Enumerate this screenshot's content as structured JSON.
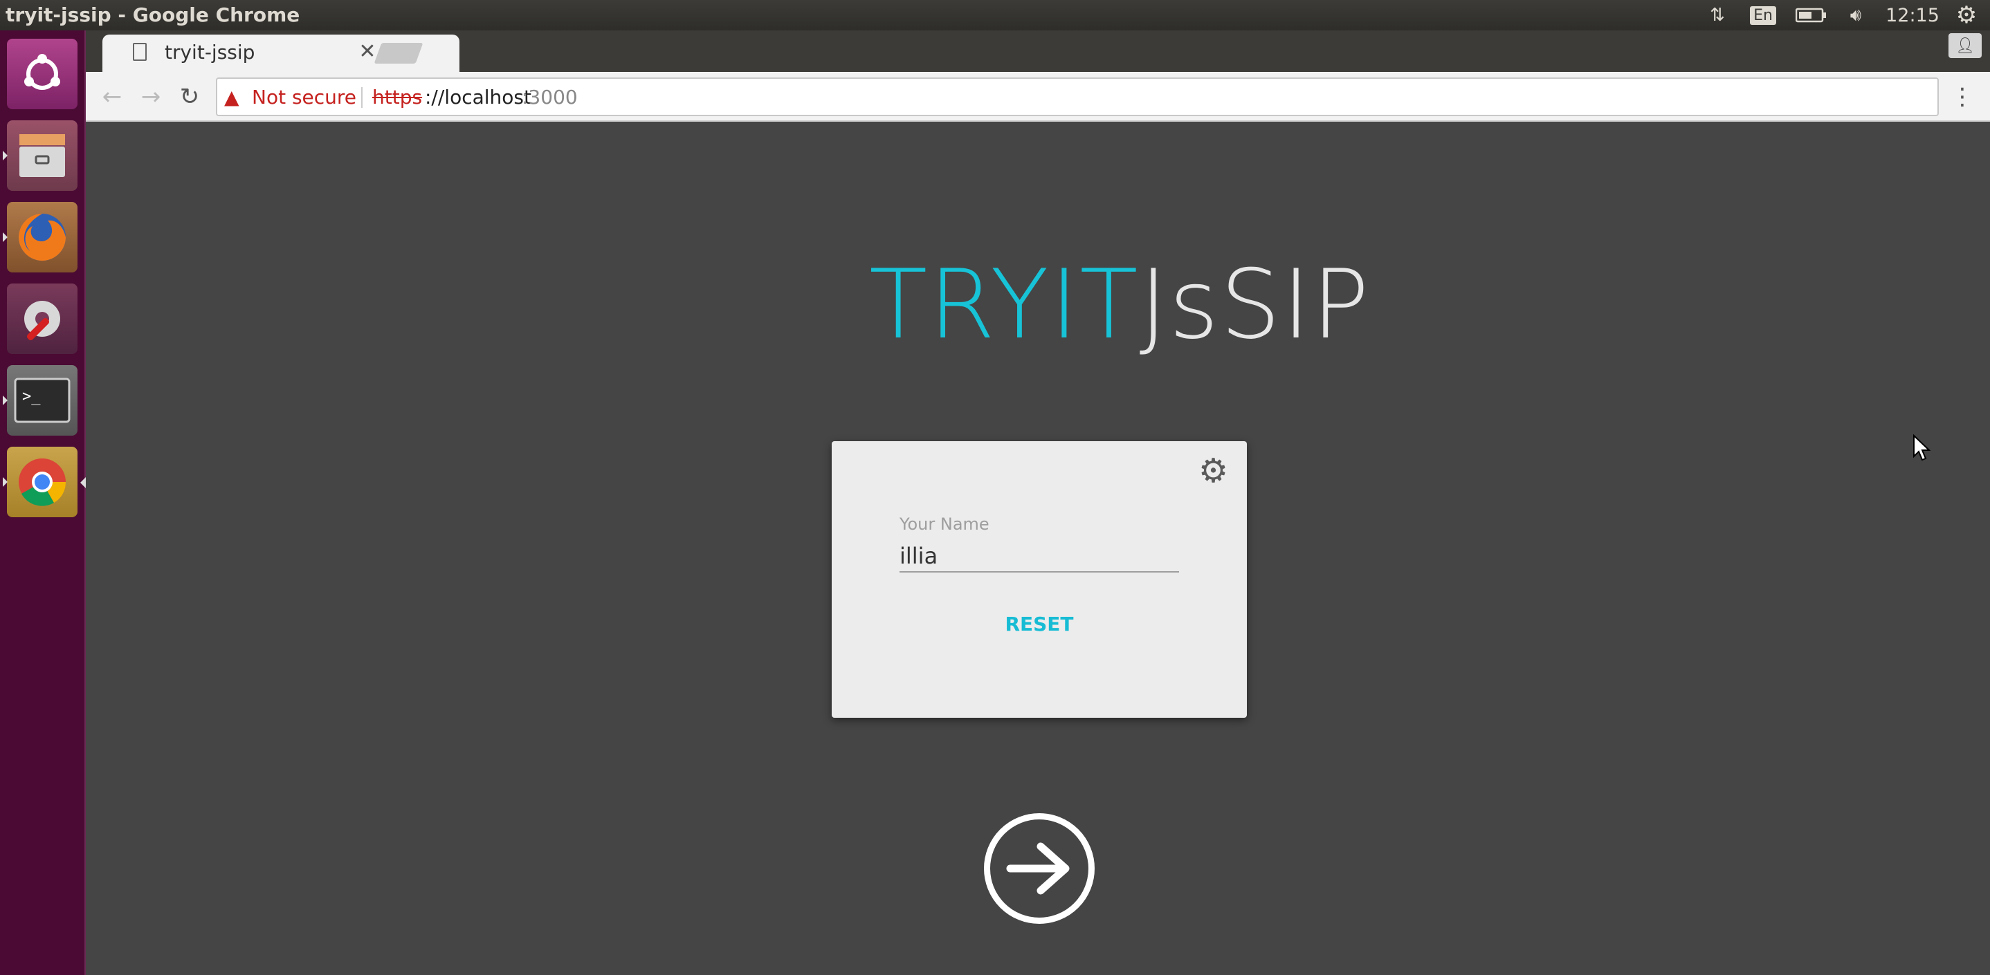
{
  "top_panel": {
    "window_title": "tryit-jssip - Google Chrome",
    "language": "En",
    "clock": "12:15"
  },
  "launcher": {
    "items": [
      {
        "name": "ubuntu",
        "icon": "ubuntu-logo-icon"
      },
      {
        "name": "files",
        "icon": "file-cabinet-icon"
      },
      {
        "name": "firefox",
        "icon": "firefox-icon"
      },
      {
        "name": "system-settings",
        "icon": "wrench-gear-icon"
      },
      {
        "name": "terminal",
        "icon": "terminal-icon"
      },
      {
        "name": "chrome",
        "icon": "chrome-icon"
      }
    ]
  },
  "browser": {
    "tab_title": "tryit-jssip",
    "security_label": "Not secure",
    "url_scheme": "https",
    "url_rest": "://localhost",
    "url_port": ":3000"
  },
  "page": {
    "logo_part1": "TRYIT",
    "logo_part2": "JsSIP",
    "name_label": "Your Name",
    "name_value": "illia",
    "reset_label": "RESET"
  },
  "colors": {
    "accent": "#17c3d7",
    "page_background": "#454545",
    "card_background": "#ececec",
    "launcher_background": "#4b0a33",
    "warning": "#c5221f"
  }
}
